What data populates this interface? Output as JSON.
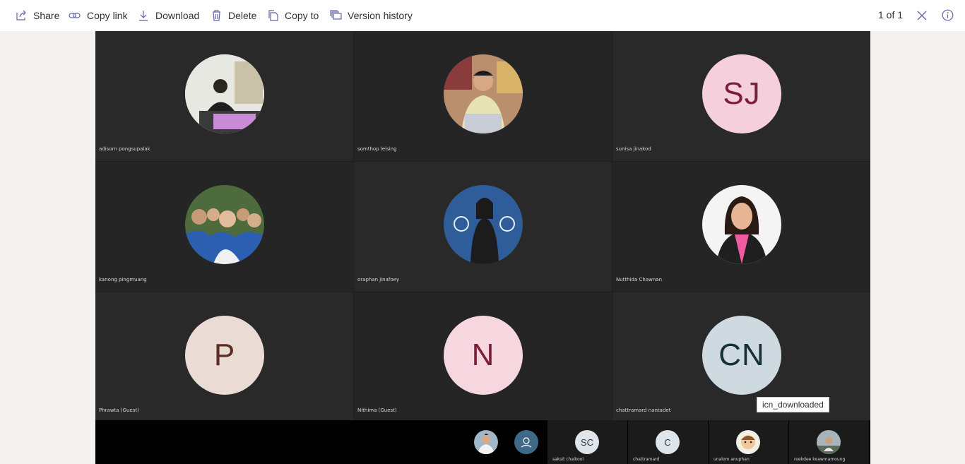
{
  "toolbar": {
    "share": "Share",
    "copy_link": "Copy link",
    "download": "Download",
    "delete": "Delete",
    "copy_to": "Copy to",
    "version_history": "Version history",
    "page_indicator": "1 of 1"
  },
  "grid": [
    {
      "name": "adisorn pongsupalak",
      "initials": "",
      "avatar_type": "photo"
    },
    {
      "name": "somthop leising",
      "initials": "",
      "avatar_type": "photo"
    },
    {
      "name": "sunisa jinakod",
      "initials": "SJ",
      "avatar_type": "initials",
      "bg": "#f6cfdc",
      "fg": "#7a1f3a"
    },
    {
      "name": "kanong pingmuang",
      "initials": "",
      "avatar_type": "photo"
    },
    {
      "name": "oraphan jinafoey",
      "initials": "",
      "avatar_type": "photo"
    },
    {
      "name": "Nutthida Chawnan",
      "initials": "",
      "avatar_type": "photo"
    },
    {
      "name": "Phrawta (Guest)",
      "initials": "P",
      "avatar_type": "initials",
      "bg": "#eadbd5",
      "fg": "#5b2e24"
    },
    {
      "name": "Nithima (Guest)",
      "initials": "N",
      "avatar_type": "initials",
      "bg": "#f6d6df",
      "fg": "#7a1f3a"
    },
    {
      "name": "chattramard nantadet",
      "initials": "CN",
      "avatar_type": "initials",
      "bg": "#cfd9e0",
      "fg": "#17303a"
    }
  ],
  "strip": [
    {
      "name": "saksit chaikool",
      "initials": "SC"
    },
    {
      "name": "chattramard",
      "initials": "C"
    },
    {
      "name": "unalom anuphan",
      "initials": ""
    },
    {
      "name": "roekdee keawmamoung",
      "initials": ""
    }
  ],
  "tooltip": "icn_downloaded",
  "colors": {
    "accent": "#6264a7",
    "toolbar_icon": "#6264a7"
  }
}
